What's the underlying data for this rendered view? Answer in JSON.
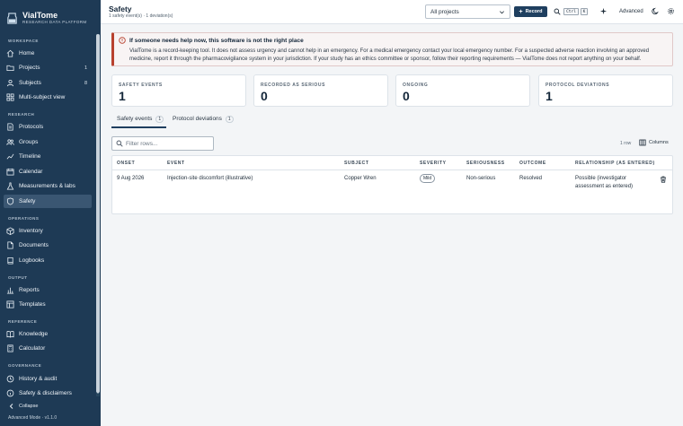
{
  "sidebar": {
    "brand_name": "VialTome",
    "brand_sub": "RESEARCH DATA PLATFORM",
    "sections": {
      "workspace": "WORKSPACE",
      "research": "RESEARCH",
      "operations": "OPERATIONS",
      "output": "OUTPUT",
      "reference": "REFERENCE",
      "governance": "GOVERNANCE"
    },
    "items": {
      "home": {
        "label": "Home",
        "icon": "home-icon"
      },
      "projects": {
        "label": "Projects",
        "count": "1",
        "icon": "folder-icon"
      },
      "subjects": {
        "label": "Subjects",
        "count": "8",
        "icon": "person-icon"
      },
      "multi_subject": {
        "label": "Multi-subject view",
        "icon": "grid-icon"
      },
      "protocols": {
        "label": "Protocols",
        "icon": "document-icon"
      },
      "groups": {
        "label": "Groups",
        "icon": "users-icon"
      },
      "timeline": {
        "label": "Timeline",
        "icon": "timeline-icon"
      },
      "calendar": {
        "label": "Calendar",
        "icon": "calendar-icon"
      },
      "measurements": {
        "label": "Measurements & labs",
        "icon": "flask-icon"
      },
      "safety": {
        "label": "Safety",
        "icon": "shield-icon"
      },
      "inventory": {
        "label": "Inventory",
        "icon": "box-icon"
      },
      "documents": {
        "label": "Documents",
        "icon": "file-icon"
      },
      "logbooks": {
        "label": "Logbooks",
        "icon": "book-icon"
      },
      "reports": {
        "label": "Reports",
        "icon": "chart-icon"
      },
      "templates": {
        "label": "Templates",
        "icon": "template-icon"
      },
      "knowledge": {
        "label": "Knowledge",
        "icon": "book-open-icon"
      },
      "calculator": {
        "label": "Calculator",
        "icon": "calculator-icon"
      },
      "history": {
        "label": "History & audit",
        "icon": "history-icon"
      },
      "disclaimers": {
        "label": "Safety & disclaimers",
        "icon": "info-icon"
      }
    },
    "collapse_label": "Collapse",
    "version": "Advanced Mode · v1.1.0"
  },
  "topbar": {
    "title": "Safety",
    "subtitle": "1 safety event(s) · 1 deviation(s)",
    "project_select": "All projects",
    "record_label": "Record",
    "kbd_ctrl": "Ctrl",
    "kbd_k": "K",
    "advanced_label": "Advanced"
  },
  "alert": {
    "title": "If someone needs help now, this software is not the right place",
    "body": "VialTome is a record-keeping tool. It does not assess urgency and cannot help in an emergency. For a medical emergency contact your local emergency number. For a suspected adverse reaction involving an approved medicine, report it through the pharmacovigilance system in your jurisdiction. If your study has an ethics committee or sponsor, follow their reporting requirements — VialTome does not report anything on your behalf."
  },
  "stats": [
    {
      "label": "SAFETY EVENTS",
      "value": "1"
    },
    {
      "label": "RECORDED AS SERIOUS",
      "value": "0"
    },
    {
      "label": "ONGOING",
      "value": "0"
    },
    {
      "label": "PROTOCOL DEVIATIONS",
      "value": "1"
    }
  ],
  "tabs": [
    {
      "label": "Safety events",
      "count": "1"
    },
    {
      "label": "Protocol deviations",
      "count": "1"
    }
  ],
  "filter": {
    "placeholder": "Filter rows..."
  },
  "table": {
    "row_count": "1 row",
    "columns_label": "Columns",
    "headers": {
      "onset": "ONSET",
      "event": "EVENT",
      "subject": "SUBJECT",
      "severity": "SEVERITY",
      "seriousness": "SERIOUSNESS",
      "outcome": "OUTCOME",
      "relationship": "RELATIONSHIP (AS ENTERED)"
    },
    "rows": [
      {
        "onset": "9 Aug 2026",
        "event": "Injection-site discomfort (illustrative)",
        "subject": "Copper Wren",
        "severity": "Mild",
        "seriousness": "Non-serious",
        "outcome": "Resolved",
        "relationship": "Possible (investigator assessment as entered)"
      }
    ]
  },
  "colors": {
    "sidebar_bg": "#1e3a55",
    "active_item": "#3a5672",
    "primary": "#1f3f5f",
    "alert_accent": "#b8412e"
  }
}
